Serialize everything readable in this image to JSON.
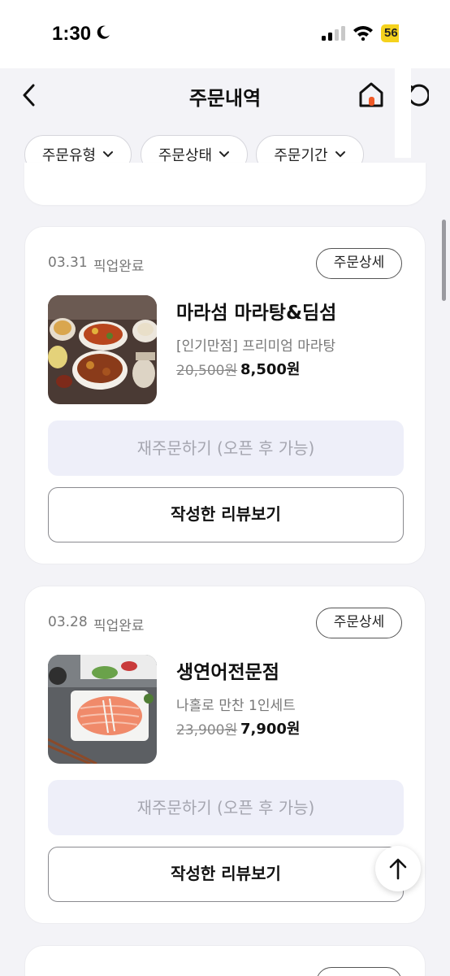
{
  "status_bar": {
    "time": "1:30",
    "battery": "56"
  },
  "header": {
    "title": "주문내역"
  },
  "filters": [
    {
      "label": "주문유형"
    },
    {
      "label": "주문상태"
    },
    {
      "label": "주문기간"
    }
  ],
  "orders": [
    {
      "date": "03.31",
      "status": "픽업완료",
      "detail_label": "주문상세",
      "store": "마라섬 마라탕&딤섬",
      "menu": "[인기만점] 프리미엄 마라탕",
      "original_price": "20,500원",
      "price": "8,500원",
      "reorder_label": "재주문하기 (오픈 후 가능)",
      "review_label": "작성한 리뷰보기"
    },
    {
      "date": "03.28",
      "status": "픽업완료",
      "detail_label": "주문상세",
      "store": "생연어전문점",
      "menu": "나홀로 만찬 1인세트",
      "original_price": "23,900원",
      "price": "7,900원",
      "reorder_label": "재주문하기 (오픈 후 가능)",
      "review_label": "작성한 리뷰보기"
    }
  ],
  "icons": {
    "back": "chevron-left-icon",
    "home": "home-icon",
    "refresh": "refresh-icon",
    "scroll_top": "arrow-up-icon"
  },
  "colors": {
    "accent": "#f05a28",
    "reorder_bg": "#eeeff9",
    "background": "#f3f3f7"
  }
}
